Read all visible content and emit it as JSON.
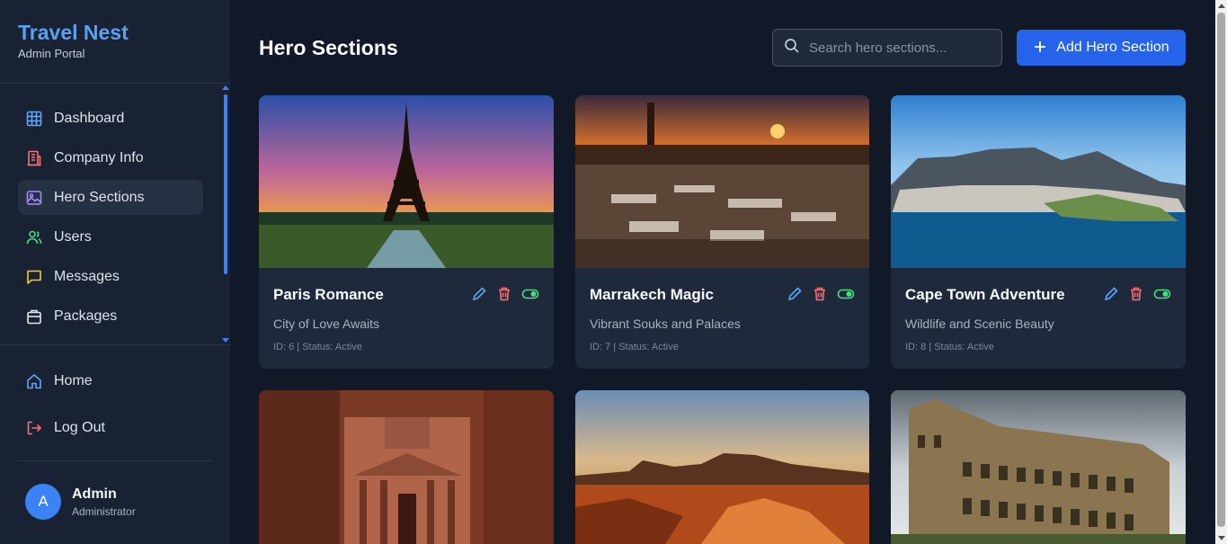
{
  "brand": {
    "title": "Travel Nest",
    "subtitle": "Admin Portal"
  },
  "nav": {
    "items": [
      {
        "label": "Dashboard",
        "icon": "grid-icon"
      },
      {
        "label": "Company Info",
        "icon": "building-icon"
      },
      {
        "label": "Hero Sections",
        "icon": "image-icon",
        "active": true
      },
      {
        "label": "Users",
        "icon": "users-icon"
      },
      {
        "label": "Messages",
        "icon": "message-icon"
      },
      {
        "label": "Packages",
        "icon": "package-icon"
      }
    ],
    "home": "Home",
    "logout": "Log Out"
  },
  "user": {
    "initial": "A",
    "name": "Admin",
    "role": "Administrator"
  },
  "header": {
    "title": "Hero Sections",
    "search_placeholder": "Search hero sections...",
    "add_label": "Add Hero Section"
  },
  "cards": [
    {
      "title": "Paris Romance",
      "subtitle": "City of Love Awaits",
      "meta": "ID: 6 | Status: Active",
      "image": "eiffel-tower-sunset"
    },
    {
      "title": "Marrakech Magic",
      "subtitle": "Vibrant Souks and Palaces",
      "meta": "ID: 7 | Status: Active",
      "image": "marrakech-market-sunset"
    },
    {
      "title": "Cape Town Adventure",
      "subtitle": "Wildlife and Scenic Beauty",
      "meta": "ID: 8 | Status: Active",
      "image": "cape-town-aerial"
    },
    {
      "title": "",
      "subtitle": "",
      "meta": "",
      "image": "petra-treasury"
    },
    {
      "title": "",
      "subtitle": "",
      "meta": "",
      "image": "desert-canyon-sunset"
    },
    {
      "title": "",
      "subtitle": "",
      "meta": "",
      "image": "rome-colosseum"
    }
  ],
  "colors": {
    "accent": "#3b82f6",
    "edit": "#60a5fa",
    "delete": "#f87171",
    "toggle": "#4ade80"
  }
}
